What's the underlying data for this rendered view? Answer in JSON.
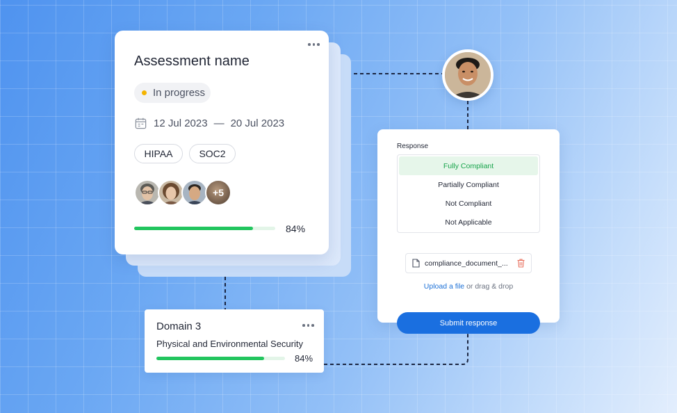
{
  "assessment": {
    "title": "Assessment name",
    "status": "In progress",
    "start_date": "12 Jul 2023",
    "date_separator": "—",
    "end_date": "20 Jul 2023",
    "tags": [
      "HIPAA",
      "SOC2"
    ],
    "extra_members": "+5",
    "progress_label": "84%",
    "progress": 0.84
  },
  "domain": {
    "title": "Domain 3",
    "subtitle": "Physical and Environmental Security",
    "progress_label": "84%",
    "progress": 0.84
  },
  "response": {
    "label": "Response",
    "options": [
      "Fully Compliant",
      "Partially Compliant",
      "Not Compliant",
      "Not Applicable"
    ],
    "selected": "Fully Compliant",
    "file_name": "compliance_document_...",
    "upload_link": "Upload a file",
    "upload_suffix": " or drag & drop",
    "submit_label": "Submit response"
  },
  "colors": {
    "accent": "#1a6fe0",
    "progress": "#22c55e",
    "status_dot": "#f4b400",
    "selected_bg": "#e6f6ea",
    "selected_text": "#16a34a",
    "delete_icon": "#e8705e"
  }
}
